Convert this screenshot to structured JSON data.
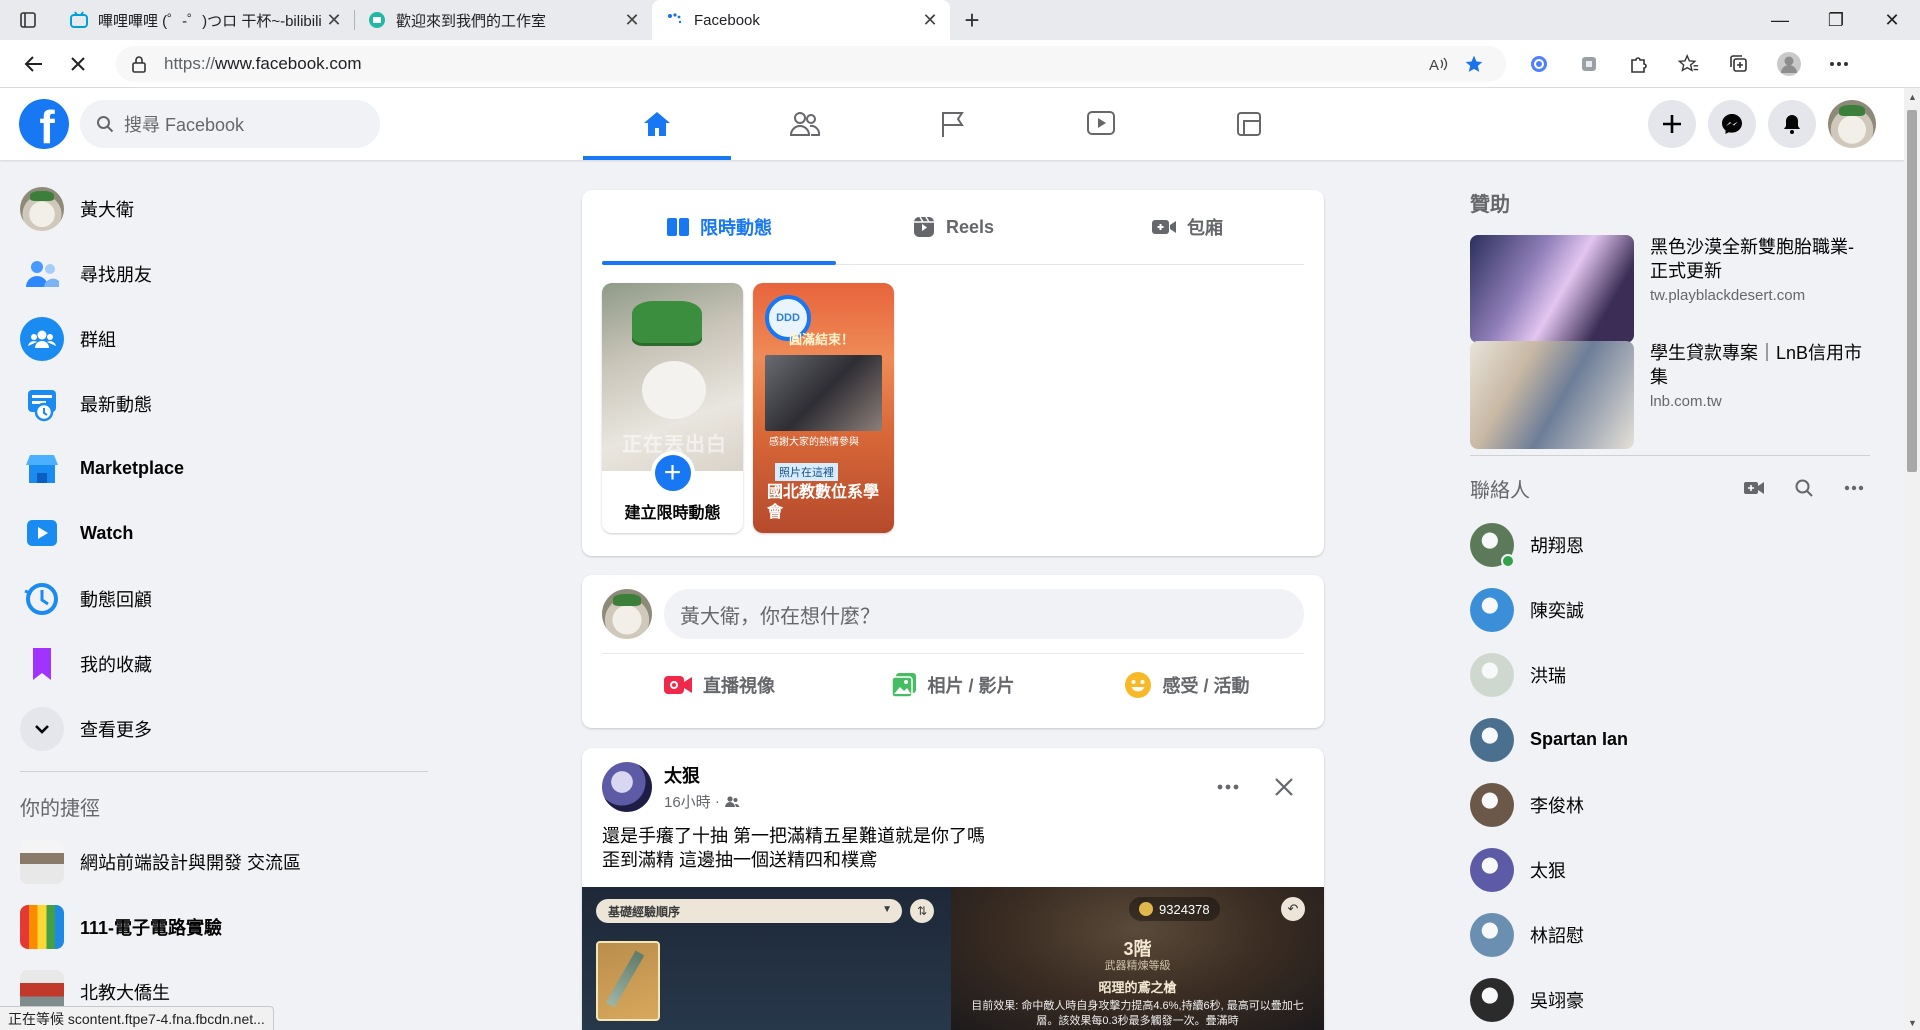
{
  "browser": {
    "tabs": [
      {
        "title": "嗶哩嗶哩 (゜-゜)つロ 干杯~-bilibili",
        "icon": "bilibili-icon",
        "active": false
      },
      {
        "title": "歡迎來到我們的工作室",
        "icon": "studio-icon",
        "active": false
      },
      {
        "title": "Facebook",
        "icon": "loading-icon",
        "active": true
      }
    ],
    "url_prefix": "https://",
    "url_host": "www.facebook.com",
    "new_tab": "+",
    "status": "正在等候 scontent.ftpe7-4.fna.fbcdn.net..."
  },
  "header": {
    "logo": "f",
    "search_placeholder": "搜尋 Facebook",
    "nav": [
      {
        "name": "home",
        "active": true
      },
      {
        "name": "friends",
        "active": false
      },
      {
        "name": "pages",
        "active": false
      },
      {
        "name": "watch",
        "active": false
      },
      {
        "name": "gaming",
        "active": false
      }
    ]
  },
  "left_sidebar": {
    "items": [
      {
        "label": "黃大衛",
        "icon": "profile-avatar",
        "bold": false
      },
      {
        "label": "尋找朋友",
        "icon": "friends-icon",
        "bold": false
      },
      {
        "label": "群組",
        "icon": "groups-icon",
        "bold": false
      },
      {
        "label": "最新動態",
        "icon": "feed-icon",
        "bold": false
      },
      {
        "label": "Marketplace",
        "icon": "marketplace-icon",
        "bold": true
      },
      {
        "label": "Watch",
        "icon": "watch-icon",
        "bold": true
      },
      {
        "label": "動態回顧",
        "icon": "memories-icon",
        "bold": false
      },
      {
        "label": "我的收藏",
        "icon": "saved-icon",
        "bold": false
      },
      {
        "label": "查看更多",
        "icon": "chevron-down-icon",
        "bold": false
      }
    ],
    "shortcuts_title": "你的捷徑",
    "shortcuts": [
      {
        "label": "網站前端設計與開發 交流區",
        "bold": false
      },
      {
        "label": "111-電子電路實驗",
        "bold": true
      },
      {
        "label": "北教大僑生",
        "bold": false
      }
    ]
  },
  "stories": {
    "tabs": [
      {
        "label": "限時動態",
        "icon": "book-icon",
        "active": true
      },
      {
        "label": "Reels",
        "icon": "reels-icon",
        "active": false
      },
      {
        "label": "包廂",
        "icon": "video-camera-icon",
        "active": false
      }
    ],
    "create_label": "建立限時動態",
    "create_overlay": "正在丟出白",
    "items": [
      {
        "name": "國北教數位系學會",
        "ring_text": "DDD",
        "poster_title": "圓滿結束！",
        "poster_caption": "感謝大家的熱情參與",
        "tag": "照片在這裡"
      }
    ]
  },
  "composer": {
    "placeholder": "黃大衛，你在想什麼？",
    "actions": [
      {
        "label": "直播視像",
        "icon": "live-video-icon",
        "color": "#f02849"
      },
      {
        "label": "相片 / 影片",
        "icon": "photo-icon",
        "color": "#45bd62"
      },
      {
        "label": "感受 / 活動",
        "icon": "smile-icon",
        "color": "#f7b928"
      }
    ]
  },
  "post": {
    "author": "太狠",
    "time": "16小時",
    "separator": "·",
    "text_line1": "還是手癢了十抽 第一把滿精五星難道就是你了嗎",
    "text_line2": "歪到滿精 這邊抽一個送精四和樸鳶",
    "image": {
      "select_label": "基礎經驗順序",
      "coins": "9324378",
      "level": "3階",
      "level_sub": "武器精煉等級",
      "weapon": "昭理的鳶之槍",
      "effect": "目前效果: 命中敵人時自身攻擊力提高4.6%,持續6秒, 最高可以疊加七層。該效果每0.3秒最多觸發一次。疊滿時"
    }
  },
  "right_sidebar": {
    "sponsored_title": "贊助",
    "ads": [
      {
        "title": "黑色沙漠全新雙胞胎職業-正式更新",
        "source": "tw.playblackdesert.com"
      },
      {
        "title": "學生貸款專案｜LnB信用市集",
        "source": "lnb.com.tw"
      }
    ],
    "contacts_title": "聯絡人",
    "contacts": [
      {
        "name": "胡翔恩",
        "online": true,
        "bold": false,
        "color": "#5c7a5a"
      },
      {
        "name": "陳奕誠",
        "online": false,
        "bold": false,
        "color": "#3a8fd8"
      },
      {
        "name": "洪瑞",
        "online": false,
        "bold": false,
        "color": "#cfd8cf"
      },
      {
        "name": "Spartan Ian",
        "online": false,
        "bold": true,
        "color": "#4a6f8f"
      },
      {
        "name": "李俊林",
        "online": false,
        "bold": false,
        "color": "#6b5848"
      },
      {
        "name": "太狠",
        "online": false,
        "bold": false,
        "color": "#5d5aa6"
      },
      {
        "name": "林詔慰",
        "online": false,
        "bold": false,
        "color": "#6a8fb0"
      },
      {
        "name": "吳翊豪",
        "online": false,
        "bold": false,
        "color": "#2b2b2b"
      }
    ]
  },
  "colors": {
    "brand": "#1877f2",
    "text_secondary": "#65676b",
    "background": "#f0f2f5"
  }
}
